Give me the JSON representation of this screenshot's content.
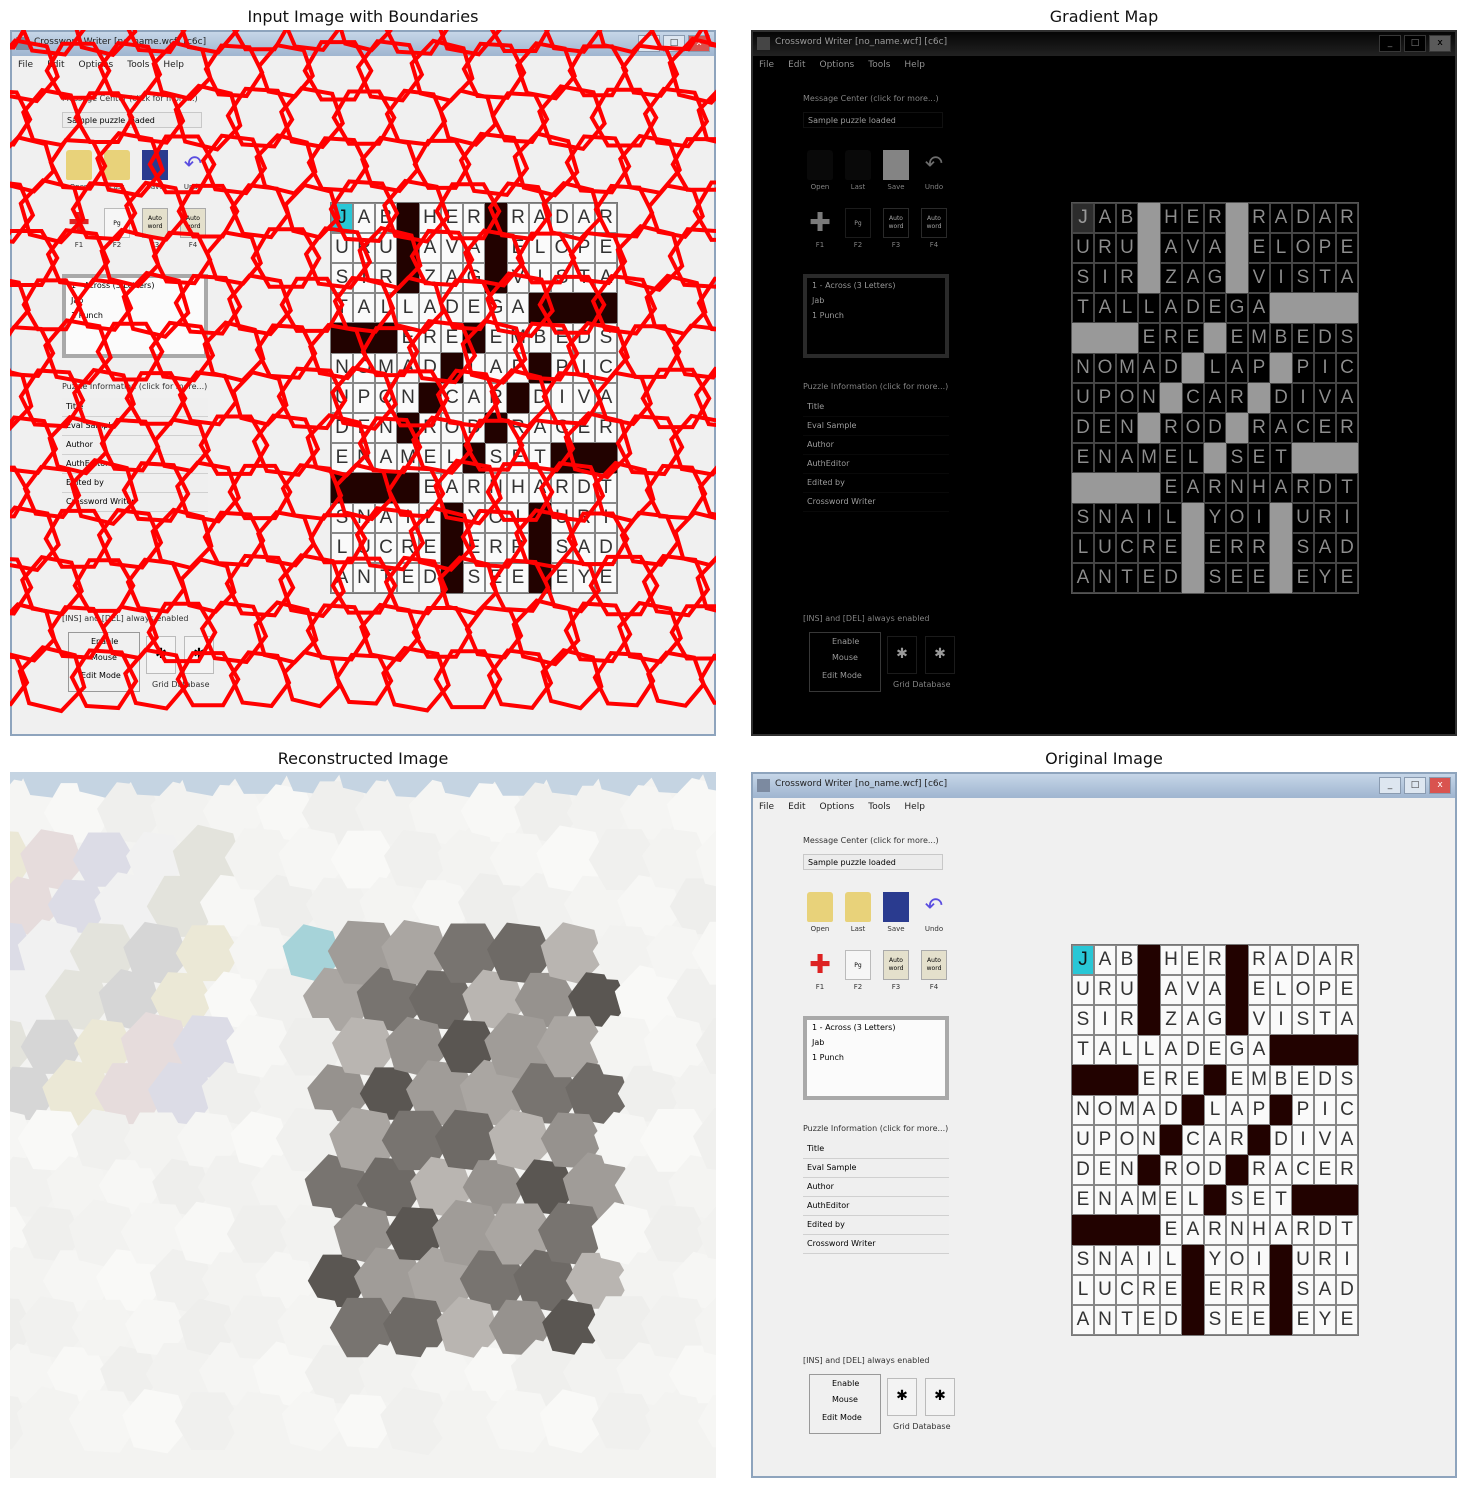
{
  "titles": {
    "top_left": "Input Image with Boundaries",
    "top_right": "Gradient Map",
    "bottom_left": "Reconstructed Image",
    "bottom_right": "Original Image"
  },
  "app": {
    "window_title": "Crossword Writer [no_name.wcf] [c6c]",
    "window_buttons": [
      "_",
      "□",
      "x"
    ],
    "menu": [
      "File",
      "Edit",
      "Options",
      "Tools",
      "Help"
    ],
    "message_center_label": "Message Center (click for more...)",
    "message_text": "Sample puzzle loaded",
    "toolbar_row1": [
      {
        "label": "Open",
        "icon": "open-folder-icon"
      },
      {
        "label": "Last",
        "icon": "last-folder-icon"
      },
      {
        "label": "Save",
        "icon": "save-disk-icon"
      },
      {
        "label": "Undo",
        "icon": "undo-arrow-icon"
      }
    ],
    "toolbar_row2": [
      {
        "label": "F1",
        "icon": "red-plus-icon",
        "text": ""
      },
      {
        "label": "F2",
        "icon": "page-icon",
        "text": "Pg"
      },
      {
        "label": "F3",
        "icon": "auto-word-icon",
        "text": "Auto word"
      },
      {
        "label": "F4",
        "icon": "auto-word-icon",
        "text": "Auto word"
      }
    ],
    "clue_box": {
      "line1": "1 - Across (3 Letters)",
      "line2": "Jab",
      "line3": "1 Punch"
    },
    "puzzle_info_label": "Puzzle Information (click for more...)",
    "puzzle_info": [
      "Title",
      "Eval Sample",
      "Author",
      "AuthEditor",
      "Edited by",
      "Crossword Writer"
    ],
    "enable_label": "[INS] and [DEL] always enabled",
    "enable_options": [
      "Enable",
      "Mouse",
      "Edit Mode"
    ],
    "grid_database_label": "Grid Database",
    "grid_rows": [
      "JAB#HER#RADAR",
      "URU#AVA#ELOPE",
      "SIR#ZAG#VISTA",
      "TALLADEGA####",
      "###ERE#EMBEDS",
      "NOMAD#LAP#PIC",
      "UPON#CAR#DIVA",
      "DEN#ROD#RACER",
      "ENAMEL#SET###",
      "####EARNHARDT",
      "SNAIL#YOI#URI",
      "LUCRE#ERR#SAD",
      "ANTED#SEE#EYE"
    ],
    "selected_cell": "J"
  },
  "colors": {
    "boundary": "#ff0000",
    "block": "#220200",
    "selected": "#29c7d6",
    "gradient_bg": "#0c0c0c"
  }
}
